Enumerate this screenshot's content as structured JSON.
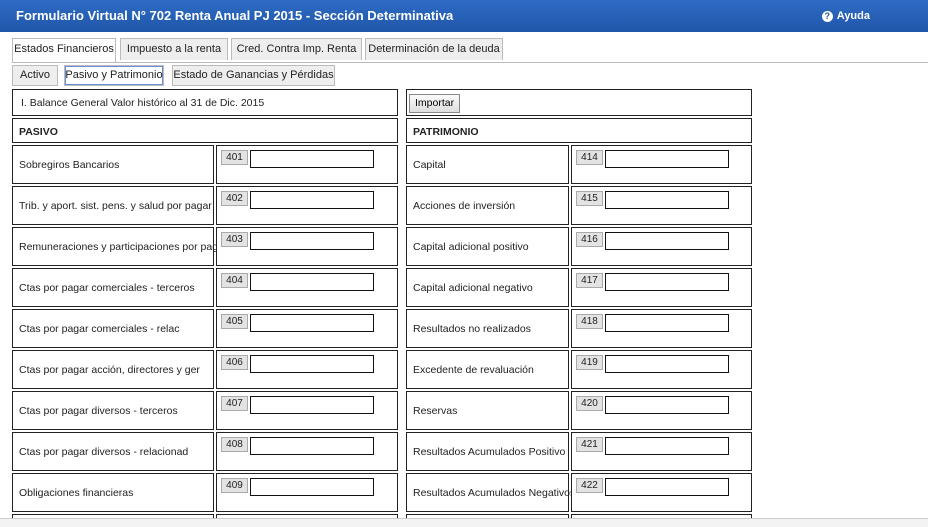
{
  "window": {
    "title": "Formulario Virtual N° 702 Renta Anual PJ 2015 - Sección Determinativa",
    "help_label": "Ayuda"
  },
  "tabs": [
    "Estados Financieros",
    "Impuesto a la renta",
    "Cred. Contra Imp. Renta",
    "Determinación de la deuda"
  ],
  "subtabs": [
    "Activo",
    "Pasivo y Patrimonio",
    "Estado de Ganancias y Pérdidas"
  ],
  "balance_title": "I. Balance General Valor histórico al 31 de Dic. 2015",
  "import_label": "Importar",
  "pasivo": {
    "header": "PASIVO",
    "rows": [
      {
        "label": "Sobregiros Bancarios",
        "code": "401",
        "value": ""
      },
      {
        "label": "Trib. y aport. sist. pens. y salud por pagar",
        "code": "402",
        "value": ""
      },
      {
        "label": "Remuneraciones y participaciones por pagar",
        "code": "403",
        "value": ""
      },
      {
        "label": "Ctas por pagar comerciales - terceros",
        "code": "404",
        "value": ""
      },
      {
        "label": "Ctas por pagar comerciales - relac",
        "code": "405",
        "value": ""
      },
      {
        "label": "Ctas por pagar acción, directores y ger",
        "code": "406",
        "value": ""
      },
      {
        "label": "Ctas por pagar diversos - terceros",
        "code": "407",
        "value": ""
      },
      {
        "label": "Ctas por pagar diversos - relacionad",
        "code": "408",
        "value": ""
      },
      {
        "label": "Obligaciones financieras",
        "code": "409",
        "value": ""
      }
    ]
  },
  "patrimonio": {
    "header": "PATRIMONIO",
    "rows": [
      {
        "label": "Capital",
        "code": "414",
        "value": ""
      },
      {
        "label": "Acciones de inversión",
        "code": "415",
        "value": ""
      },
      {
        "label": "Capital adicional positivo",
        "code": "416",
        "value": ""
      },
      {
        "label": "Capital adicional negativo",
        "code": "417",
        "value": ""
      },
      {
        "label": "Resultados no realizados",
        "code": "418",
        "value": ""
      },
      {
        "label": "Excedente de revaluación",
        "code": "419",
        "value": ""
      },
      {
        "label": "Reservas",
        "code": "420",
        "value": ""
      },
      {
        "label": "Resultados Acumulados Positivo",
        "code": "421",
        "value": ""
      },
      {
        "label": "Resultados Acumulados Negativos",
        "code": "422",
        "value": ""
      }
    ]
  }
}
